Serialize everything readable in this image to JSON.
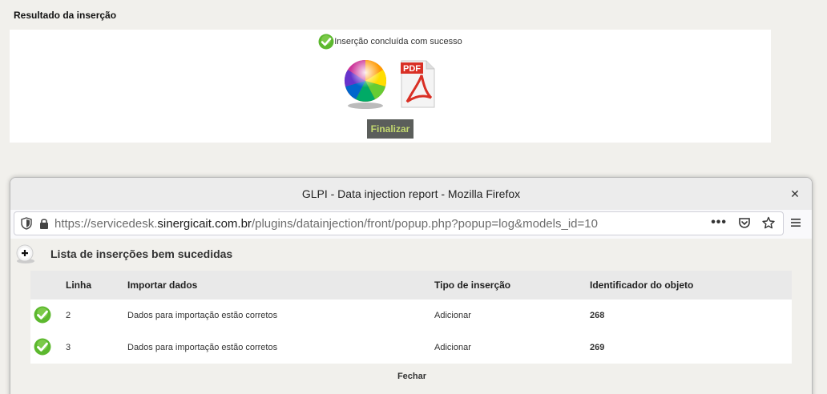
{
  "result_panel": {
    "title": "Resultado da inserção",
    "success_message": "Inserção concluída com sucesso",
    "finalize_label": "Finalizar"
  },
  "firefox": {
    "window_title": "GLPI - Data injection report - Mozilla Firefox",
    "url_prefix": "https://servicedesk.",
    "url_domain": "sinergicait.com.br",
    "url_path": "/plugins/datainjection/front/popup.php?popup=log&models_id=10"
  },
  "report": {
    "list_title": "Lista de inserções bem sucedidas",
    "columns": [
      "Linha",
      "Importar dados",
      "Tipo de inserção",
      "Identificador do objeto"
    ],
    "rows": [
      {
        "line": "2",
        "data": "Dados para importação estão corretos",
        "type": "Adicionar",
        "id": "268"
      },
      {
        "line": "3",
        "data": "Dados para importação estão corretos",
        "type": "Adicionar",
        "id": "269"
      }
    ],
    "close_label": "Fechar"
  },
  "colors": {
    "success_green": "#5cb82e",
    "finalize_bg": "#5b5e5b",
    "finalize_text": "#c3d96f"
  }
}
